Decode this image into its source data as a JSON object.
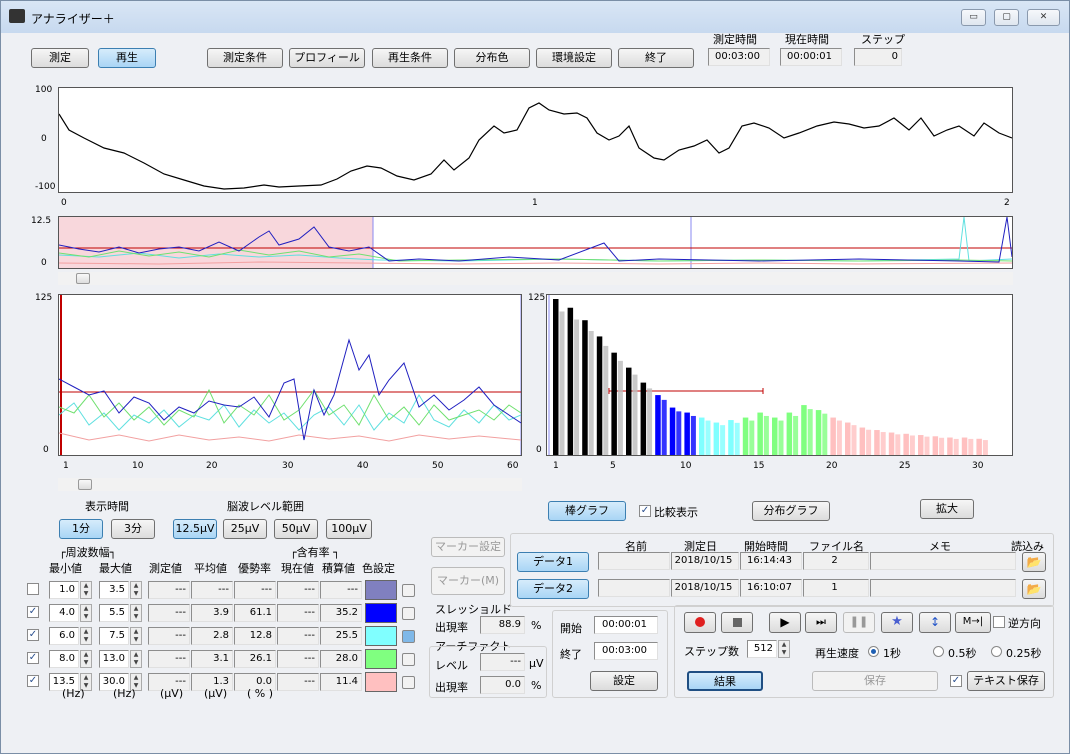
{
  "window": {
    "title": "アナライザー＋",
    "min": "▭",
    "max": "▢",
    "close": "✕"
  },
  "toolbar": {
    "measure": "測定",
    "replay": "再生",
    "cond": "測定条件",
    "profile": "プロフィール",
    "replay_cond": "再生条件",
    "dist_color": "分布色",
    "env": "環境設定",
    "quit": "終了"
  },
  "status": {
    "measure_time_label": "測定時間",
    "measure_time": "00:03:00",
    "current_time_label": "現在時間",
    "current_time": "00:00:01",
    "step_label": "ステップ",
    "step": "0"
  },
  "top_chart": {
    "y_ticks": [
      "100",
      "0",
      "-100"
    ],
    "x_ticks": [
      "0",
      "1",
      "2"
    ]
  },
  "overview_chart": {
    "y_ticks": [
      "12.5",
      "0"
    ]
  },
  "wave_chart": {
    "y_ticks": [
      "125",
      "0"
    ],
    "x_ticks": [
      "1",
      "10",
      "20",
      "30",
      "40",
      "50",
      "60"
    ]
  },
  "chart_data": {
    "type": "bar",
    "y_ticks": [
      "125",
      "0"
    ],
    "categories": [
      "1",
      "5",
      "10",
      "15",
      "20",
      "25",
      "30"
    ],
    "values": [
      125,
      118,
      108,
      95,
      82,
      70,
      58,
      48,
      38,
      34,
      30,
      26,
      28,
      30,
      34,
      30,
      34,
      40,
      36,
      30,
      26,
      22,
      20,
      18,
      17,
      16,
      15,
      14,
      14,
      13
    ],
    "series_colors": [
      "#000000",
      "#000000",
      "#000000",
      "#000000",
      "#000000",
      "#000000",
      "#000000",
      "#0000ff",
      "#0000ff",
      "#0000ff",
      "#80ffff",
      "#80ffff",
      "#80ffff",
      "#80ff80",
      "#80ff80",
      "#80ff80",
      "#80ff80",
      "#80ff80",
      "#80ff80",
      "#ffc0c0",
      "#ffc0c0",
      "#ffc0c0",
      "#ffc0c0",
      "#ffc0c0",
      "#ffc0c0",
      "#ffc0c0",
      "#ffc0c0",
      "#ffc0c0",
      "#ffc0c0",
      "#ffc0c0"
    ]
  },
  "controls": {
    "display_time": "表示時間",
    "brain_level": "脳波レベル範囲",
    "t1": "1分",
    "t3": "3分",
    "l1": "12.5μV",
    "l2": "25μV",
    "l3": "50μV",
    "l4": "100μV",
    "bar_graph": "棒グラフ",
    "compare": "比較表示",
    "dist_graph": "分布グラフ",
    "zoom": "拡大"
  },
  "table": {
    "freq_width": "┌周波数幅┐",
    "content_rate": "┌含有率 ┐",
    "headers": [
      "最小値",
      "最大値",
      "測定値",
      "平均値",
      "優勢率",
      "現在値",
      "積算値",
      "色設定"
    ],
    "units": [
      "(Hz)",
      "(Hz)",
      "(μV)",
      "(μV)",
      "( % )"
    ],
    "rows": [
      {
        "min": "1.0",
        "max": "3.5",
        "measured": "---",
        "avg": "---",
        "dom": "---",
        "now": "---",
        "sum": "---",
        "color": "#8080c0",
        "checked": ""
      },
      {
        "min": "4.0",
        "max": "5.5",
        "measured": "---",
        "avg": "3.9",
        "dom": "61.1",
        "now": "---",
        "sum": "35.2",
        "color": "#0000ff",
        "checked": "✓"
      },
      {
        "min": "6.0",
        "max": "7.5",
        "measured": "---",
        "avg": "2.8",
        "dom": "12.8",
        "now": "---",
        "sum": "25.5",
        "color": "#80ffff",
        "checked": "✓"
      },
      {
        "min": "8.0",
        "max": "13.0",
        "measured": "---",
        "avg": "3.1",
        "dom": "26.1",
        "now": "---",
        "sum": "28.0",
        "color": "#80ff80",
        "checked": "✓"
      },
      {
        "min": "13.5",
        "max": "30.0",
        "measured": "---",
        "avg": "1.3",
        "dom": "0.0",
        "now": "---",
        "sum": "11.4",
        "color": "#ffc0c0",
        "checked": "✓"
      }
    ]
  },
  "marker": {
    "settings": "マーカー設定",
    "marker": "マーカー(M)",
    "threshold": "スレッショルド",
    "rate_label": "出現率",
    "rate": "88.9",
    "pct": "%",
    "artifact": "アーチファクト",
    "level_label": "レベル",
    "level": "---",
    "uv": "μV",
    "rate2": "0.0"
  },
  "data_panel": {
    "name": "名前",
    "date": "測定日",
    "start": "開始時間",
    "file": "ファイル名",
    "memo": "メモ",
    "load": "読込み",
    "rows": [
      {
        "btn": "データ1",
        "date": "2018/10/15",
        "time": "16:14:43",
        "file": "2"
      },
      {
        "btn": "データ2",
        "date": "2018/10/15",
        "time": "16:10:07",
        "file": "1"
      }
    ]
  },
  "range": {
    "start_label": "開始",
    "start": "00:00:01",
    "end_label": "終了",
    "end": "00:03:00",
    "set": "設定"
  },
  "player": {
    "reverse": "逆方向",
    "steps_label": "ステップ数",
    "steps": "512",
    "speed_label": "再生速度",
    "s1": "1秒",
    "s2": "0.5秒",
    "s3": "0.25秒",
    "result": "結果",
    "save": "保存",
    "text_save": "テキスト保存"
  }
}
